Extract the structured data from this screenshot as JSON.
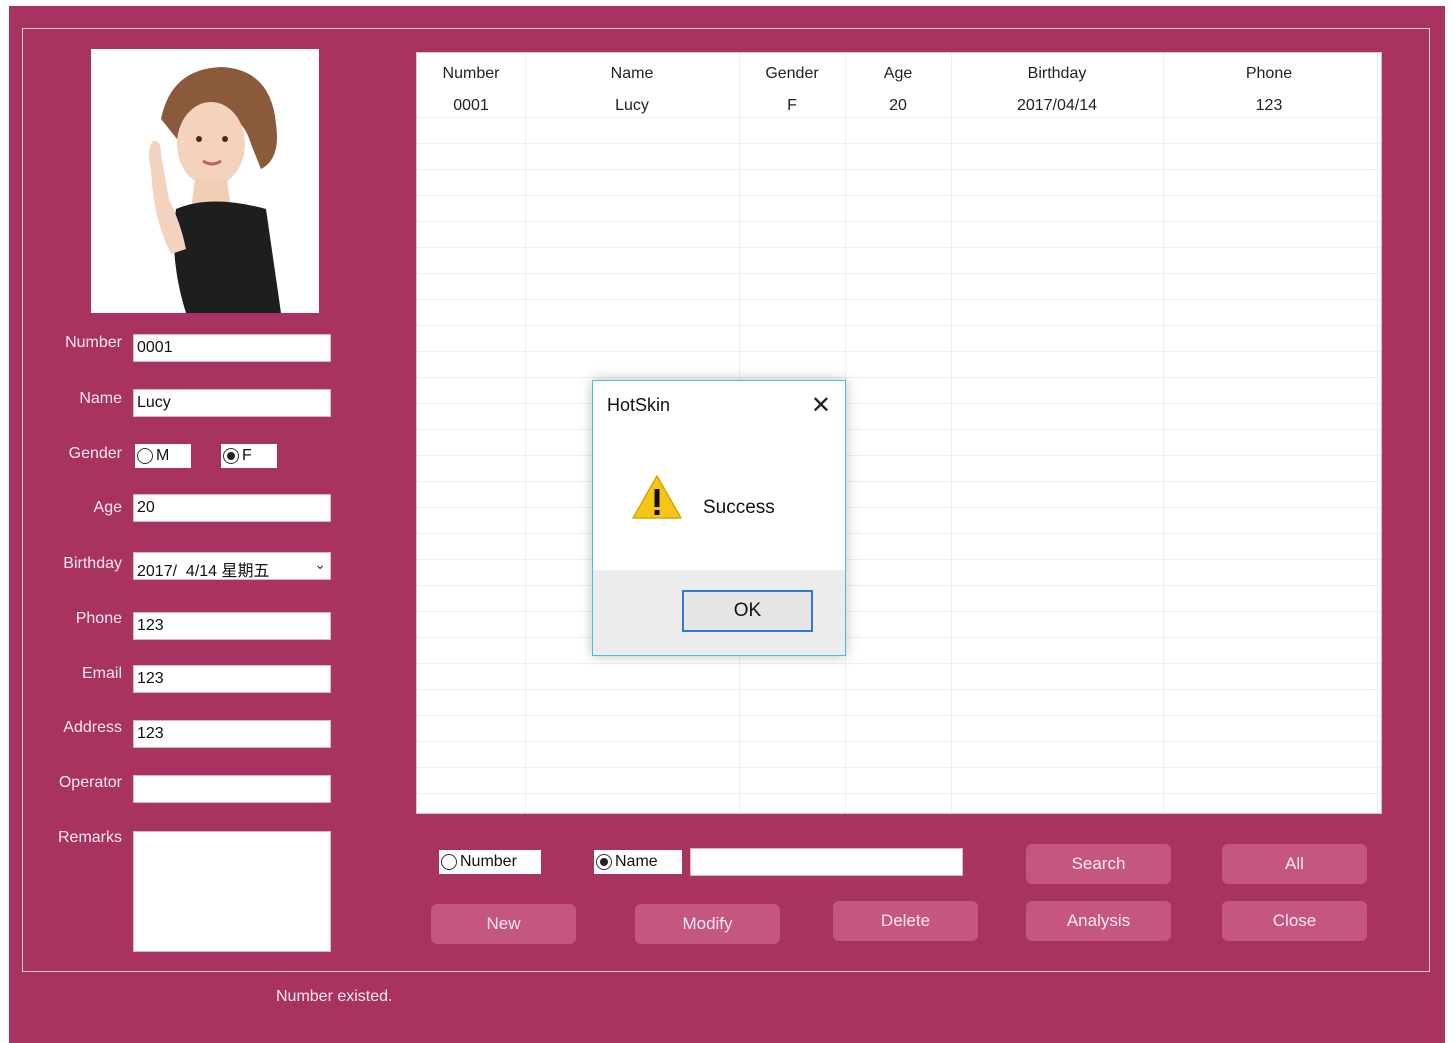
{
  "form": {
    "number_label": "Number",
    "number_value": "0001",
    "name_label": "Name",
    "name_value": "Lucy",
    "gender_label": "Gender",
    "gender_m": "M",
    "gender_f": "F",
    "gender_selected": "F",
    "age_label": "Age",
    "age_value": "20",
    "birthday_label": "Birthday",
    "birthday_value": "2017/  4/14 星期五",
    "phone_label": "Phone",
    "phone_value": "123",
    "email_label": "Email",
    "email_value": "123",
    "address_label": "Address",
    "address_value": "123",
    "operator_label": "Operator",
    "operator_value": "",
    "remarks_label": "Remarks",
    "remarks_value": ""
  },
  "table": {
    "columns": [
      "Number",
      "Name",
      "Gender",
      "Age",
      "Birthday",
      "Phone"
    ],
    "rows": [
      [
        "0001",
        "Lucy",
        "F",
        "20",
        "2017/04/14",
        "123"
      ]
    ]
  },
  "search": {
    "radio_number": "Number",
    "radio_name": "Name",
    "selected": "Name",
    "query": ""
  },
  "buttons": {
    "search": "Search",
    "all": "All",
    "new": "New",
    "modify": "Modify",
    "delete": "Delete",
    "analysis": "Analysis",
    "close": "Close"
  },
  "status_text": "Number existed.",
  "dialog": {
    "title": "HotSkin",
    "close_glyph": "✕",
    "message": "Success",
    "ok_label": "OK",
    "icon": "warning-icon"
  },
  "colors": {
    "window_bg": "#a93360",
    "button_bg": "#c45680",
    "dialog_border": "#3fbfe6"
  }
}
